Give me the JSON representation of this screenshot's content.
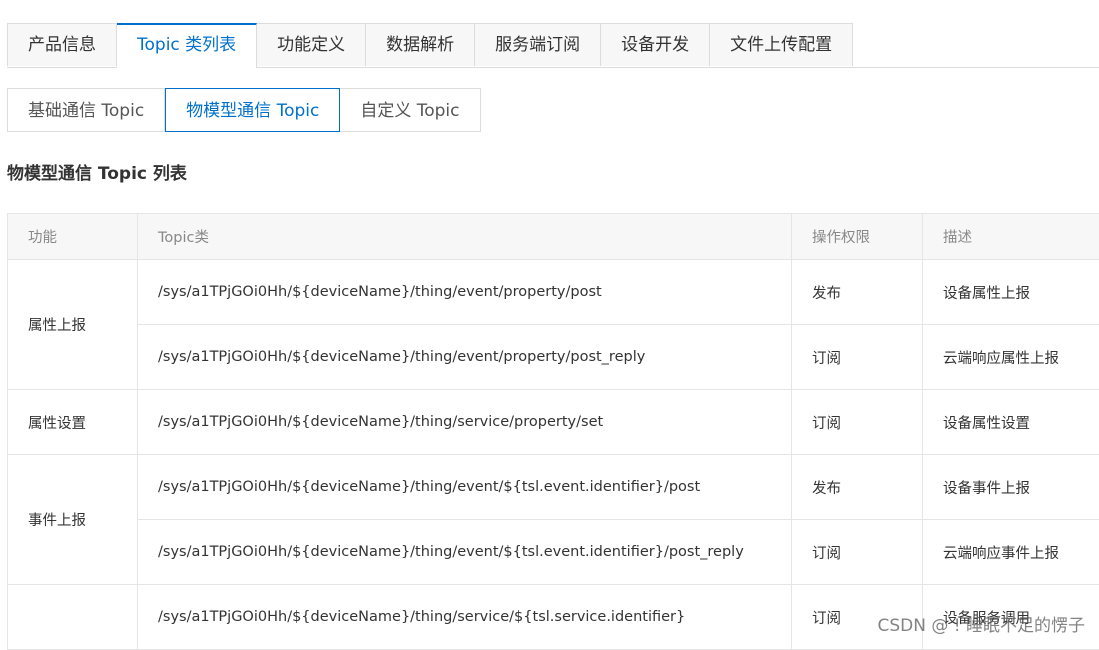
{
  "top_tabs": [
    "产品信息",
    "Topic 类列表",
    "功能定义",
    "数据解析",
    "服务端订阅",
    "设备开发",
    "文件上传配置"
  ],
  "sub_tabs": [
    "基础通信 Topic",
    "物模型通信 Topic",
    "自定义 Topic"
  ],
  "section_title": "物模型通信 Topic 列表",
  "table": {
    "headers": [
      "功能",
      "Topic类",
      "操作权限",
      "描述"
    ],
    "rows": [
      {
        "feature": "属性上报",
        "topic": "/sys/a1TPjGOi0Hh/${deviceName}/thing/event/property/post",
        "permission": "发布",
        "desc": "设备属性上报"
      },
      {
        "feature": "",
        "topic": "/sys/a1TPjGOi0Hh/${deviceName}/thing/event/property/post_reply",
        "permission": "订阅",
        "desc": "云端响应属性上报"
      },
      {
        "feature": "属性设置",
        "topic": "/sys/a1TPjGOi0Hh/${deviceName}/thing/service/property/set",
        "permission": "订阅",
        "desc": "设备属性设置"
      },
      {
        "feature": "事件上报",
        "topic": "/sys/a1TPjGOi0Hh/${deviceName}/thing/event/${tsl.event.identifier}/post",
        "permission": "发布",
        "desc": "设备事件上报"
      },
      {
        "feature": "",
        "topic": "/sys/a1TPjGOi0Hh/${deviceName}/thing/event/${tsl.event.identifier}/post_reply",
        "permission": "订阅",
        "desc": "云端响应事件上报"
      },
      {
        "feature": "",
        "topic": "/sys/a1TPjGOi0Hh/${deviceName}/thing/service/${tsl.service.identifier}",
        "permission": "订阅",
        "desc": "设备服务调用"
      }
    ]
  },
  "watermark": "CSDN @ ! 睡眠不足的愣子"
}
